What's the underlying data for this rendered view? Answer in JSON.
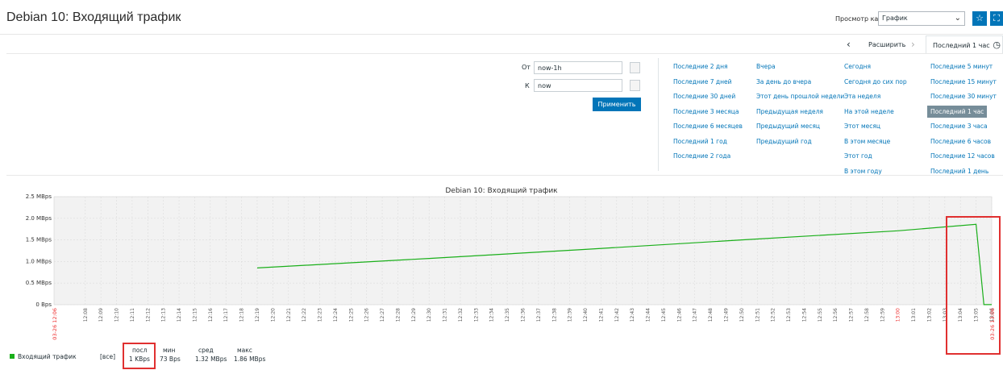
{
  "header": {
    "title": "Debian 10: Входящий трафик",
    "view_as_label": "Просмотр как",
    "view_as_value": "График"
  },
  "icons": {
    "favorite": "star-icon",
    "fullscreen": "fullscreen-icon",
    "clock": "clock-icon",
    "calendar": "calendar-icon"
  },
  "nav": {
    "zoom_out": "Расширить",
    "current_period": "Последний 1 час"
  },
  "filter": {
    "from_label": "От",
    "from_value": "now-1h",
    "to_label": "К",
    "to_value": "now",
    "apply_label": "Применить",
    "quick_ranges": [
      [
        "Последние 2 дня",
        "Последние 7 дней",
        "Последние 30 дней",
        "Последние 3 месяца",
        "Последние 6 месяцев",
        "Последний 1 год",
        "Последние 2 года"
      ],
      [
        "Вчера",
        "За день до вчера",
        "Этот день прошлой недели",
        "Предыдущая неделя",
        "Предыдущий месяц",
        "Предыдущий год"
      ],
      [
        "Сегодня",
        "Сегодня до сих пор",
        "Эта неделя",
        "На этой неделе",
        "Этот месяц",
        "В этом месяце",
        "Этот год",
        "В этом году"
      ],
      [
        "Последние 5 минут",
        "Последние 15 минут",
        "Последние 30 минут",
        "Последний 1 час",
        "Последние 3 часа",
        "Последние 6 часов",
        "Последние 12 часов",
        "Последний 1 день"
      ]
    ],
    "selected": "Последний 1 час"
  },
  "chart_data": {
    "type": "line",
    "title": "Debian 10: Входящий трафик",
    "y_ticks": [
      "2.5 MBps",
      "2.0 MBps",
      "1.5 MBps",
      "1.0 MBps",
      "0.5 MBps",
      "0 Bps"
    ],
    "ylim": [
      0,
      2.5
    ],
    "y_unit": "MBps",
    "x_start_label": "03-26 12:06",
    "x_end_label": "03-26 13:06",
    "x_minute_labels": [
      "12:08",
      "12:09",
      "12:10",
      "12:11",
      "12:12",
      "12:13",
      "12:14",
      "12:15",
      "12:16",
      "12:17",
      "12:18",
      "12:19",
      "12:20",
      "12:21",
      "12:22",
      "12:23",
      "12:24",
      "12:25",
      "12:26",
      "12:27",
      "12:28",
      "12:29",
      "12:30",
      "12:31",
      "12:32",
      "12:33",
      "12:34",
      "12:35",
      "12:36",
      "12:37",
      "12:38",
      "12:39",
      "12:40",
      "12:41",
      "12:42",
      "12:43",
      "12:44",
      "12:45",
      "12:46",
      "12:47",
      "12:48",
      "12:49",
      "12:50",
      "12:51",
      "12:52",
      "12:53",
      "12:54",
      "12:55",
      "12:56",
      "12:57",
      "12:58",
      "12:59",
      "13:00",
      "13:01",
      "13:02",
      "13:03",
      "13:04",
      "13:05",
      "13:06"
    ],
    "x_red_labels": [
      "13:00"
    ],
    "series": [
      {
        "name": "Входящий трафик",
        "color": "#1aaf1a",
        "points": [
          [
            "12:19",
            0.85
          ],
          [
            "12:30",
            1.07
          ],
          [
            "12:40",
            1.28
          ],
          [
            "12:50",
            1.5
          ],
          [
            "13:00",
            1.71
          ],
          [
            "13:05",
            1.86
          ],
          [
            "13:05.5",
            0.001
          ],
          [
            "13:06",
            0.001
          ]
        ]
      }
    ],
    "grid": true
  },
  "legend": {
    "series_name": "Входящий трафик",
    "func": "[все]",
    "cols": [
      {
        "label": "посл",
        "value": "1 KBps"
      },
      {
        "label": "мин",
        "value": "73 Bps"
      },
      {
        "label": "сред",
        "value": "1.32 MBps"
      },
      {
        "label": "макс",
        "value": "1.86 MBps"
      }
    ]
  }
}
